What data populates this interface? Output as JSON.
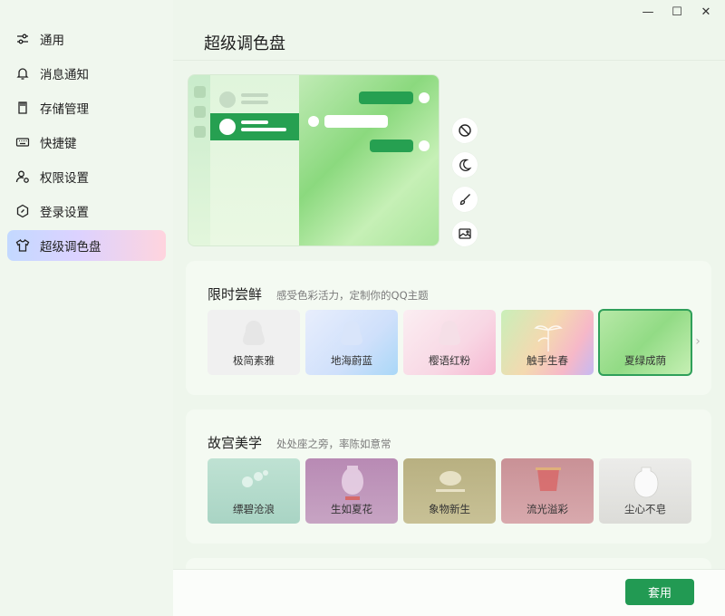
{
  "window": {
    "minimize": "—",
    "maximize": "☐",
    "close": "✕"
  },
  "sidebar": {
    "items": [
      {
        "label": "通用",
        "icon": "sliders-icon"
      },
      {
        "label": "消息通知",
        "icon": "bell-icon"
      },
      {
        "label": "存储管理",
        "icon": "storage-icon"
      },
      {
        "label": "快捷键",
        "icon": "keyboard-icon"
      },
      {
        "label": "权限设置",
        "icon": "user-permission-icon"
      },
      {
        "label": "登录设置",
        "icon": "hexagon-icon"
      },
      {
        "label": "超级调色盘",
        "icon": "shirt-icon",
        "active": true
      }
    ]
  },
  "main": {
    "title": "超级调色盘",
    "tools": [
      "disable-icon",
      "moon-icon",
      "brush-icon",
      "image-icon"
    ],
    "sections": [
      {
        "title": "限时尝鲜",
        "subtitle": "感受色彩活力，定制你的QQ主题",
        "cards": [
          {
            "label": "极简素雅"
          },
          {
            "label": "地海蔚蓝"
          },
          {
            "label": "樱语红粉"
          },
          {
            "label": "触手生春"
          },
          {
            "label": "夏绿成荫",
            "selected": true
          }
        ]
      },
      {
        "title": "故宫美学",
        "subtitle": "处处座之旁，率陈如意常",
        "cards": [
          {
            "label": "缥碧沧浪"
          },
          {
            "label": "生如夏花"
          },
          {
            "label": "象物新生"
          },
          {
            "label": "流光溢彩"
          },
          {
            "label": "尘心不皂"
          }
        ]
      }
    ],
    "apply_label": "套用"
  },
  "colors": {
    "accent": "#229a53",
    "selected_border": "#2f9f5a",
    "sidebar_bg": "#f0f7ee"
  }
}
